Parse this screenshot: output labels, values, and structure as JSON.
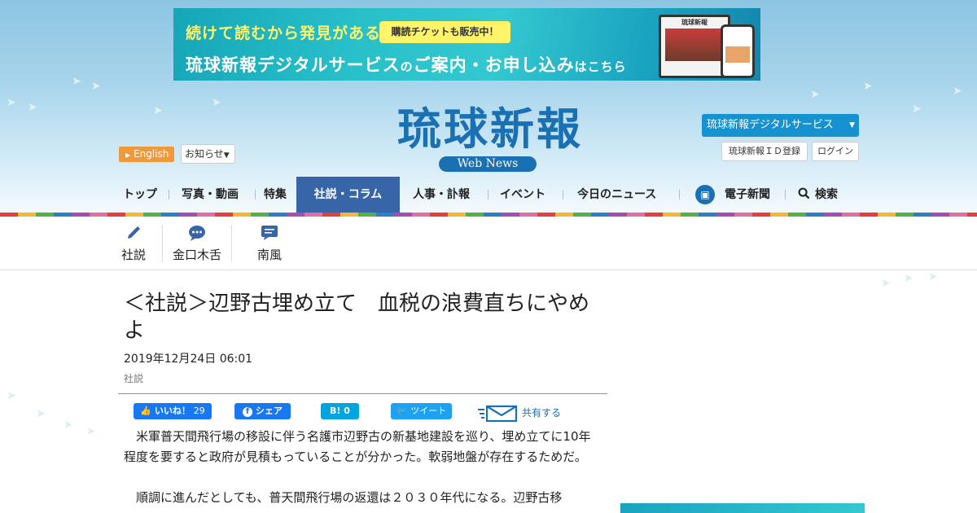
{
  "banner": {
    "line1": "続けて読むから発見がある",
    "pill": "購読チケットも販売中！",
    "line2_a": "琉球新報デジタルサービス",
    "line2_b": "のご案内・お申し込み",
    "line2_c": "はこちら",
    "monitor_title": "琉球新報"
  },
  "header": {
    "english_label": "English",
    "notice_label": "お知らせ",
    "logo_text": "琉球新報",
    "logo_sub": "Web News",
    "digital_service_label": "琉球新報デジタルサービス",
    "id_register_label": "琉球新報ＩＤ登録",
    "login_label": "ログイン"
  },
  "nav": {
    "items": [
      {
        "label": "トップ"
      },
      {
        "label": "写真・動画"
      },
      {
        "label": "特集"
      },
      {
        "label": "社説・コラム"
      },
      {
        "label": "人事・訃報"
      },
      {
        "label": "イベント"
      },
      {
        "label": "今日のニュース"
      },
      {
        "label": "電子新聞"
      },
      {
        "label": "検索"
      }
    ],
    "active": "社説・コラム"
  },
  "subnav": {
    "items": [
      {
        "label": "社説",
        "icon": "pen-icon"
      },
      {
        "label": "金口木舌",
        "icon": "speech-bubble-icon"
      },
      {
        "label": "南風",
        "icon": "chat-lines-icon"
      }
    ]
  },
  "article": {
    "title": "＜社説＞辺野古埋め立て　血税の浪費直ちにやめよ",
    "date": "2019年12月24日 06:01",
    "category": "社説",
    "share": {
      "fb_like": "いいね！",
      "fb_like_count": "29",
      "fb_share": "シェア",
      "hatena": "B!",
      "hatena_count": "0",
      "tweet": "ツイート",
      "mail": "共有する"
    },
    "paragraphs": [
      "米軍普天間飛行場の移設に伴う名護市辺野古の新基地建設を巡り、埋め立てに10年程度を要すると政府が見積もっていることが分かった。軟弱地盤が存在するためだ。",
      "順調に進んだとしても、普天間飛行場の返還は２０３０年代になる。辺野古移"
    ]
  },
  "colors": {
    "brand_blue": "#1970b3",
    "nav_active": "#3865a8",
    "english_orange": "#f0993a",
    "digital_blue": "#1592cf"
  }
}
